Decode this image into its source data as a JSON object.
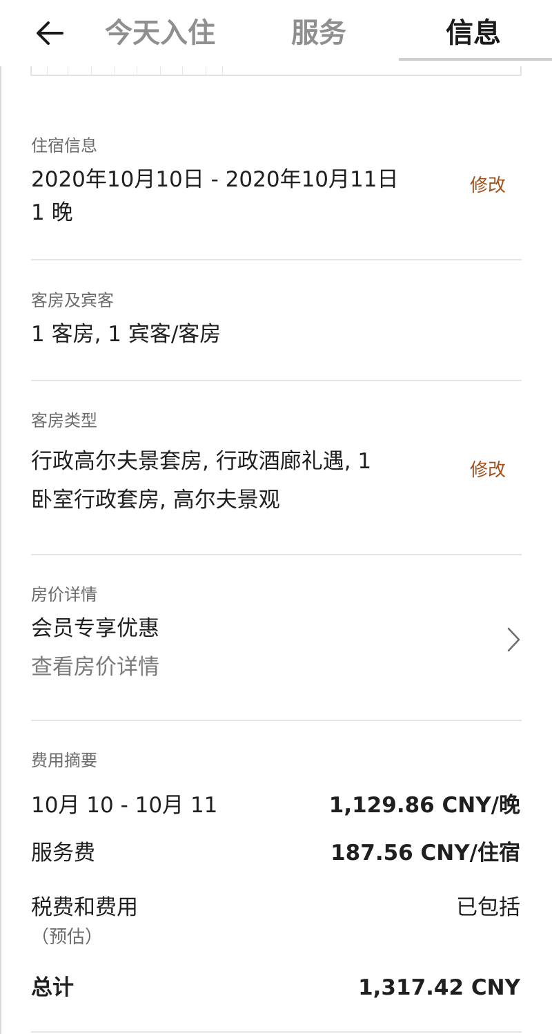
{
  "header": {
    "tabs": [
      "今天入住",
      "服务",
      "信息"
    ],
    "active_tab": "信息"
  },
  "stay": {
    "label": "住宿信息",
    "dates": "2020年10月10日 - 2020年10月11日",
    "nights": "1 晚",
    "edit": "修改"
  },
  "guests": {
    "label": "客房及宾客",
    "value": "1 客房, 1 宾客/客房"
  },
  "room_type": {
    "label": "客房类型",
    "line1": "行政高尔夫景套房, 行政酒廊礼遇, 1",
    "line2": "卧室行政套房, 高尔夫景观",
    "edit": "修改"
  },
  "rate": {
    "label": "房价详情",
    "name": "会员专享优惠",
    "link": "查看房价详情"
  },
  "summary": {
    "label": "费用摘要",
    "rows": [
      {
        "k": "10月 10 - 10月 11",
        "v": "1,129.86 CNY/晚"
      },
      {
        "k": "服务费",
        "v": "187.56 CNY/住宿"
      },
      {
        "k": "税费和费用",
        "v": "已包括",
        "sub": "（预估）"
      }
    ],
    "total_label": "总计",
    "total_value": "1,317.42 CNY"
  },
  "colors": {
    "accent": "#a0521d",
    "text": "#1f1f1f",
    "muted": "#7a7a7a",
    "divider": "#e5e5e5"
  }
}
